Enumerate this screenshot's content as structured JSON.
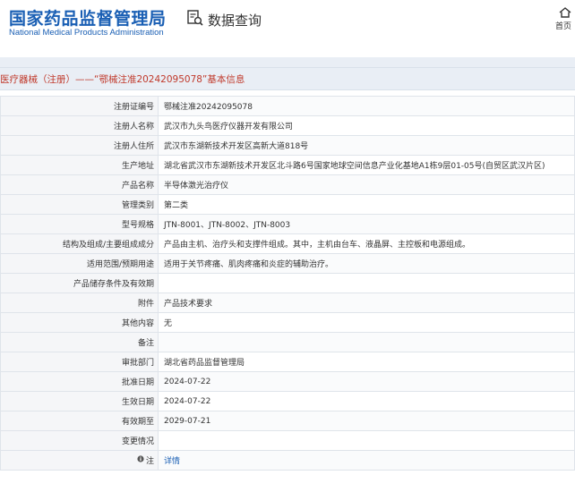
{
  "header": {
    "logo_cn": "国家药品监督管理局",
    "logo_en": "National Medical Products Administration",
    "query_label": "数据查询",
    "query_icon": "data-query-icon",
    "home_label": "首页",
    "home_icon": "home-icon"
  },
  "title": "医疗器械（注册）——“鄂械注准20242095078”基本信息",
  "rows": [
    {
      "label": "注册证编号",
      "value": "鄂械注准20242095078"
    },
    {
      "label": "注册人名称",
      "value": "武汉市九头鸟医疗仪器开发有限公司"
    },
    {
      "label": "注册人住所",
      "value": "武汉市东湖新技术开发区高新大道818号"
    },
    {
      "label": "生产地址",
      "value": "湖北省武汉市东湖新技术开发区北斗路6号国家地球空间信息产业化基地A1栋9层01-05号(自贸区武汉片区)"
    },
    {
      "label": "产品名称",
      "value": "半导体激光治疗仪"
    },
    {
      "label": "管理类别",
      "value": "第二类"
    },
    {
      "label": "型号规格",
      "value": "JTN-8001、JTN-8002、JTN-8003"
    },
    {
      "label": "结构及组成/主要组成成分",
      "value": "产品由主机、治疗头和支撑件组成。其中，主机由台车、液晶屏、主控板和电源组成。"
    },
    {
      "label": "适用范围/预期用途",
      "value": "适用于关节疼痛、肌肉疼痛和炎症的辅助治疗。"
    },
    {
      "label": "产品储存条件及有效期",
      "value": ""
    },
    {
      "label": "附件",
      "value": "产品技术要求"
    },
    {
      "label": "其他内容",
      "value": "无"
    },
    {
      "label": "备注",
      "value": ""
    },
    {
      "label": "审批部门",
      "value": "湖北省药品监督管理局"
    },
    {
      "label": "批准日期",
      "value": "2024-07-22"
    },
    {
      "label": "生效日期",
      "value": "2024-07-22"
    },
    {
      "label": "有效期至",
      "value": "2029-07-21"
    },
    {
      "label": "变更情况",
      "value": ""
    },
    {
      "label": "注",
      "value": "详情",
      "icon": "info-icon"
    }
  ],
  "colors": {
    "brand": "#1a5fb4",
    "title": "#c0392b",
    "link": "#1a5fb4"
  }
}
